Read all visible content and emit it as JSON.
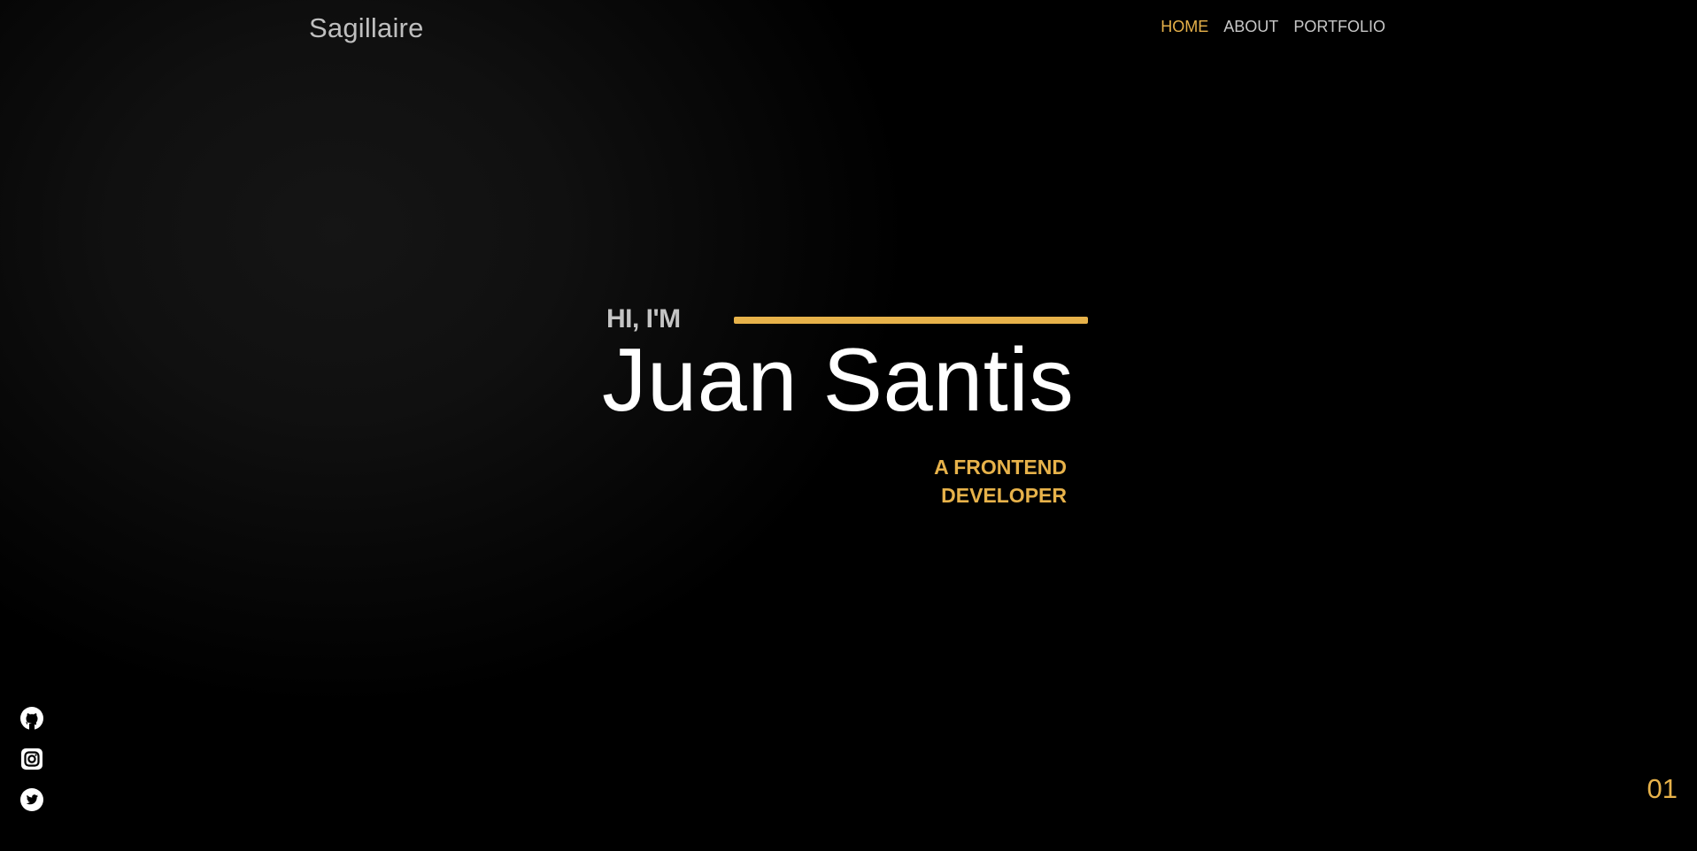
{
  "header": {
    "logo": "Sagillaire",
    "nav": [
      {
        "label": "HOME",
        "active": true
      },
      {
        "label": "ABOUT",
        "active": false
      },
      {
        "label": "PORTFOLIO",
        "active": false
      }
    ]
  },
  "hero": {
    "greeting": "HI, I'M",
    "name": "Juan Santis",
    "role_line1": "A FRONTEND",
    "role_line2": "DEVELOPER"
  },
  "social": [
    {
      "icon": "github-icon"
    },
    {
      "icon": "instagram-icon"
    },
    {
      "icon": "twitter-icon"
    }
  ],
  "page_number": "01",
  "colors": {
    "accent": "#e7b24a",
    "background": "#000000",
    "text": "#ffffff",
    "muted": "#c4c4c4"
  }
}
